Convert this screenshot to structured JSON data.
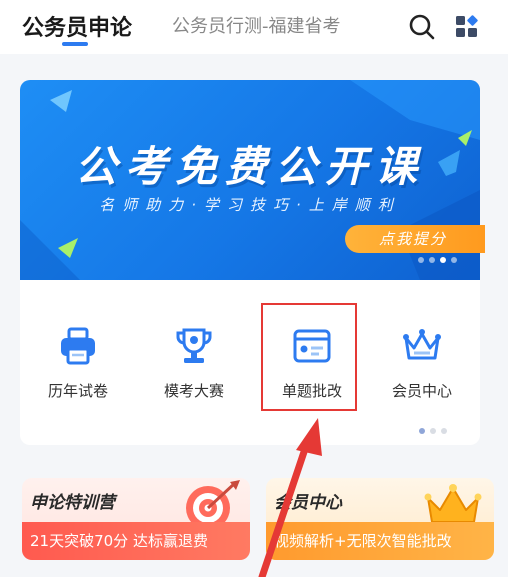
{
  "header": {
    "tabs": [
      {
        "label": "公务员申论",
        "active": true
      },
      {
        "label": "公务员行测-福建省考",
        "active": false
      }
    ],
    "icons": [
      "search-icon",
      "grid-menu-icon"
    ]
  },
  "banner": {
    "title": "公考免费公开课",
    "subtitle": "名师助力·学习技巧·上岸顺利",
    "cta": "点我提分",
    "dots": 4,
    "active_dot": 3
  },
  "features": [
    {
      "label": "历年试卷",
      "icon": "exam-paper-printer-icon"
    },
    {
      "label": "模考大赛",
      "icon": "trophy-icon"
    },
    {
      "label": "单题批改",
      "icon": "single-question-correct-icon"
    },
    {
      "label": "会员中心",
      "icon": "crown-icon"
    }
  ],
  "promos": [
    {
      "title": "申论特训营",
      "subtitle": "21天突破70分 达标赢退费",
      "icon": "target-icon"
    },
    {
      "title": "会员中心",
      "subtitle": "视频解析+无限次智能批改",
      "icon": "gold-crown-icon"
    }
  ],
  "annotation": {
    "highlighted_feature": "单题批改",
    "color": "#e53935"
  },
  "colors": {
    "accent": "#2d7bf0",
    "banner_blue": "#1577e6",
    "cta_orange": "#ff9a1e",
    "highlight_red": "#e53935"
  }
}
